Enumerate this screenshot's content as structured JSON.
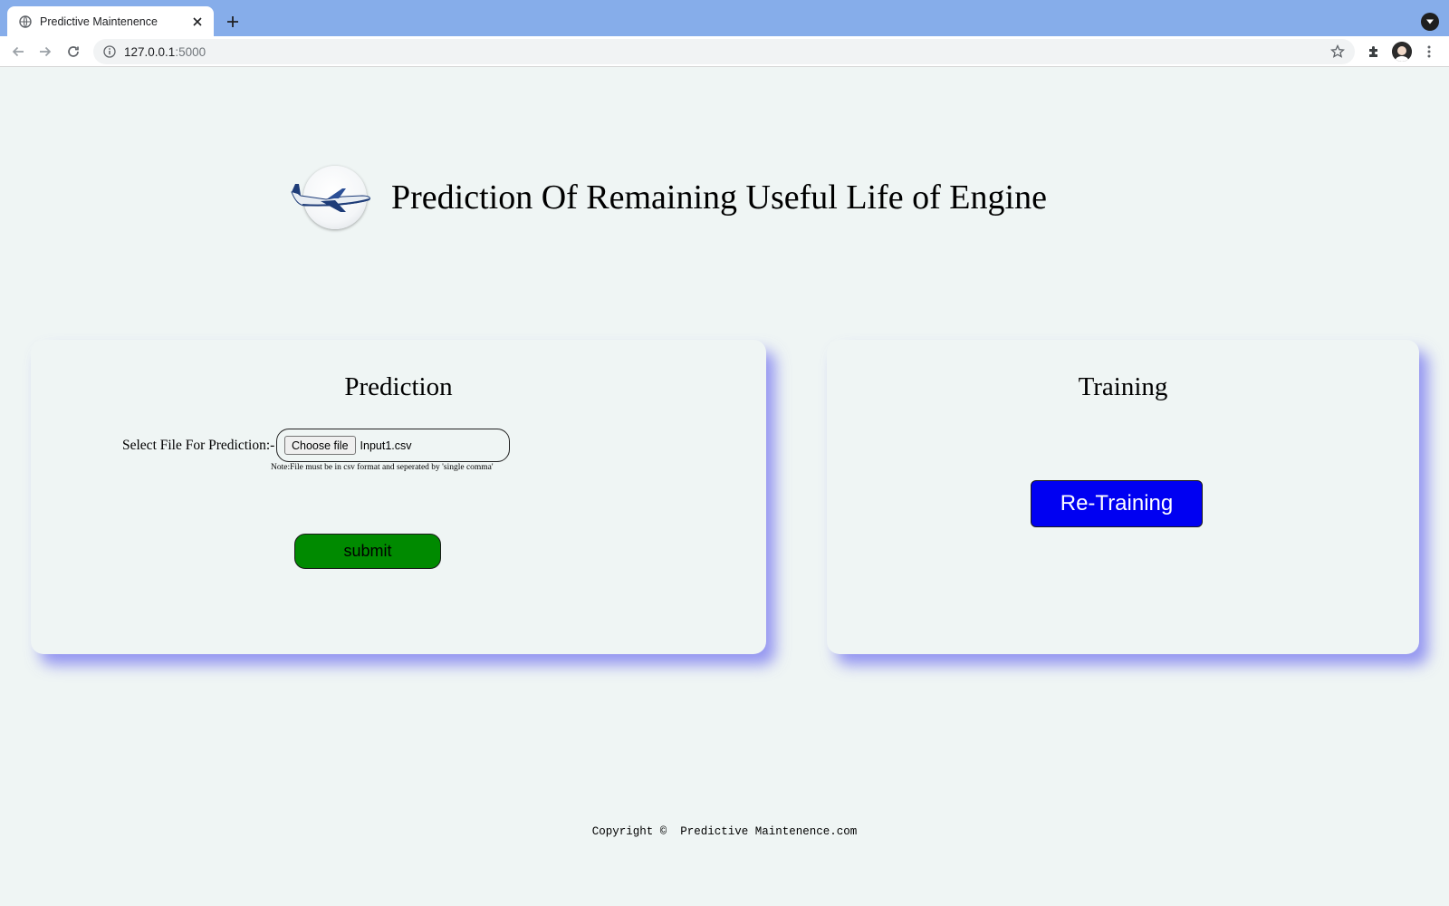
{
  "browser": {
    "tab_title": "Predictive Maintenence",
    "url_host": "127.0.0.1",
    "url_port": ":5000"
  },
  "header": {
    "logo": "airplane-logo",
    "title": "Prediction Of Remaining Useful Life of Engine"
  },
  "prediction": {
    "title": "Prediction",
    "file_label": "Select File For Prediction:-",
    "choose_file_label": "Choose file",
    "file_name": "Input1.csv",
    "note": "Note:File must be in csv format and seperated by 'single comma'",
    "submit_label": "submit",
    "submit_color": "#008a00"
  },
  "training": {
    "title": "Training",
    "retrain_label": "Re-Training",
    "retrain_color": "#0000f2"
  },
  "footer": {
    "copyright": "Copyright ©  Predictive Maintenence.com"
  }
}
